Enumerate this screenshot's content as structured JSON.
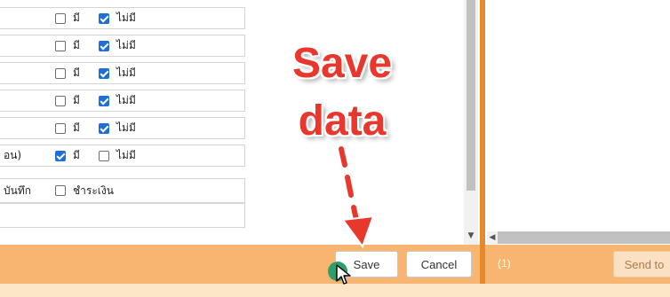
{
  "form": {
    "rows": [
      {
        "label": "",
        "opt1": {
          "text": "มี",
          "checked": false
        },
        "opt2": {
          "text": "ไม่มี",
          "checked": true
        }
      },
      {
        "label": "",
        "opt1": {
          "text": "มี",
          "checked": false
        },
        "opt2": {
          "text": "ไม่มี",
          "checked": true
        }
      },
      {
        "label": "",
        "opt1": {
          "text": "มี",
          "checked": false
        },
        "opt2": {
          "text": "ไม่มี",
          "checked": true
        }
      },
      {
        "label": "",
        "opt1": {
          "text": "มี",
          "checked": false
        },
        "opt2": {
          "text": "ไม่มี",
          "checked": true
        }
      },
      {
        "label": "",
        "opt1": {
          "text": "มี",
          "checked": false
        },
        "opt2": {
          "text": "ไม่มี",
          "checked": true
        }
      },
      {
        "label": "อน)",
        "opt1": {
          "text": "มี",
          "checked": true
        },
        "opt2": {
          "text": "ไม่มี",
          "checked": false
        }
      }
    ],
    "payment_row": {
      "prefix": "บันทึก",
      "option": "ชำระเงิน",
      "checked": false
    }
  },
  "footer": {
    "save_label": "Save",
    "cancel_label": "Cancel",
    "count_label": "(1)",
    "send_label": "Send to"
  },
  "annotation": {
    "line1": "Save",
    "line2": "data"
  },
  "colors": {
    "accent": "#f7b571",
    "divider": "#e58a2b",
    "checkbox": "#1f6fd6",
    "annotation": "#e8382d"
  }
}
